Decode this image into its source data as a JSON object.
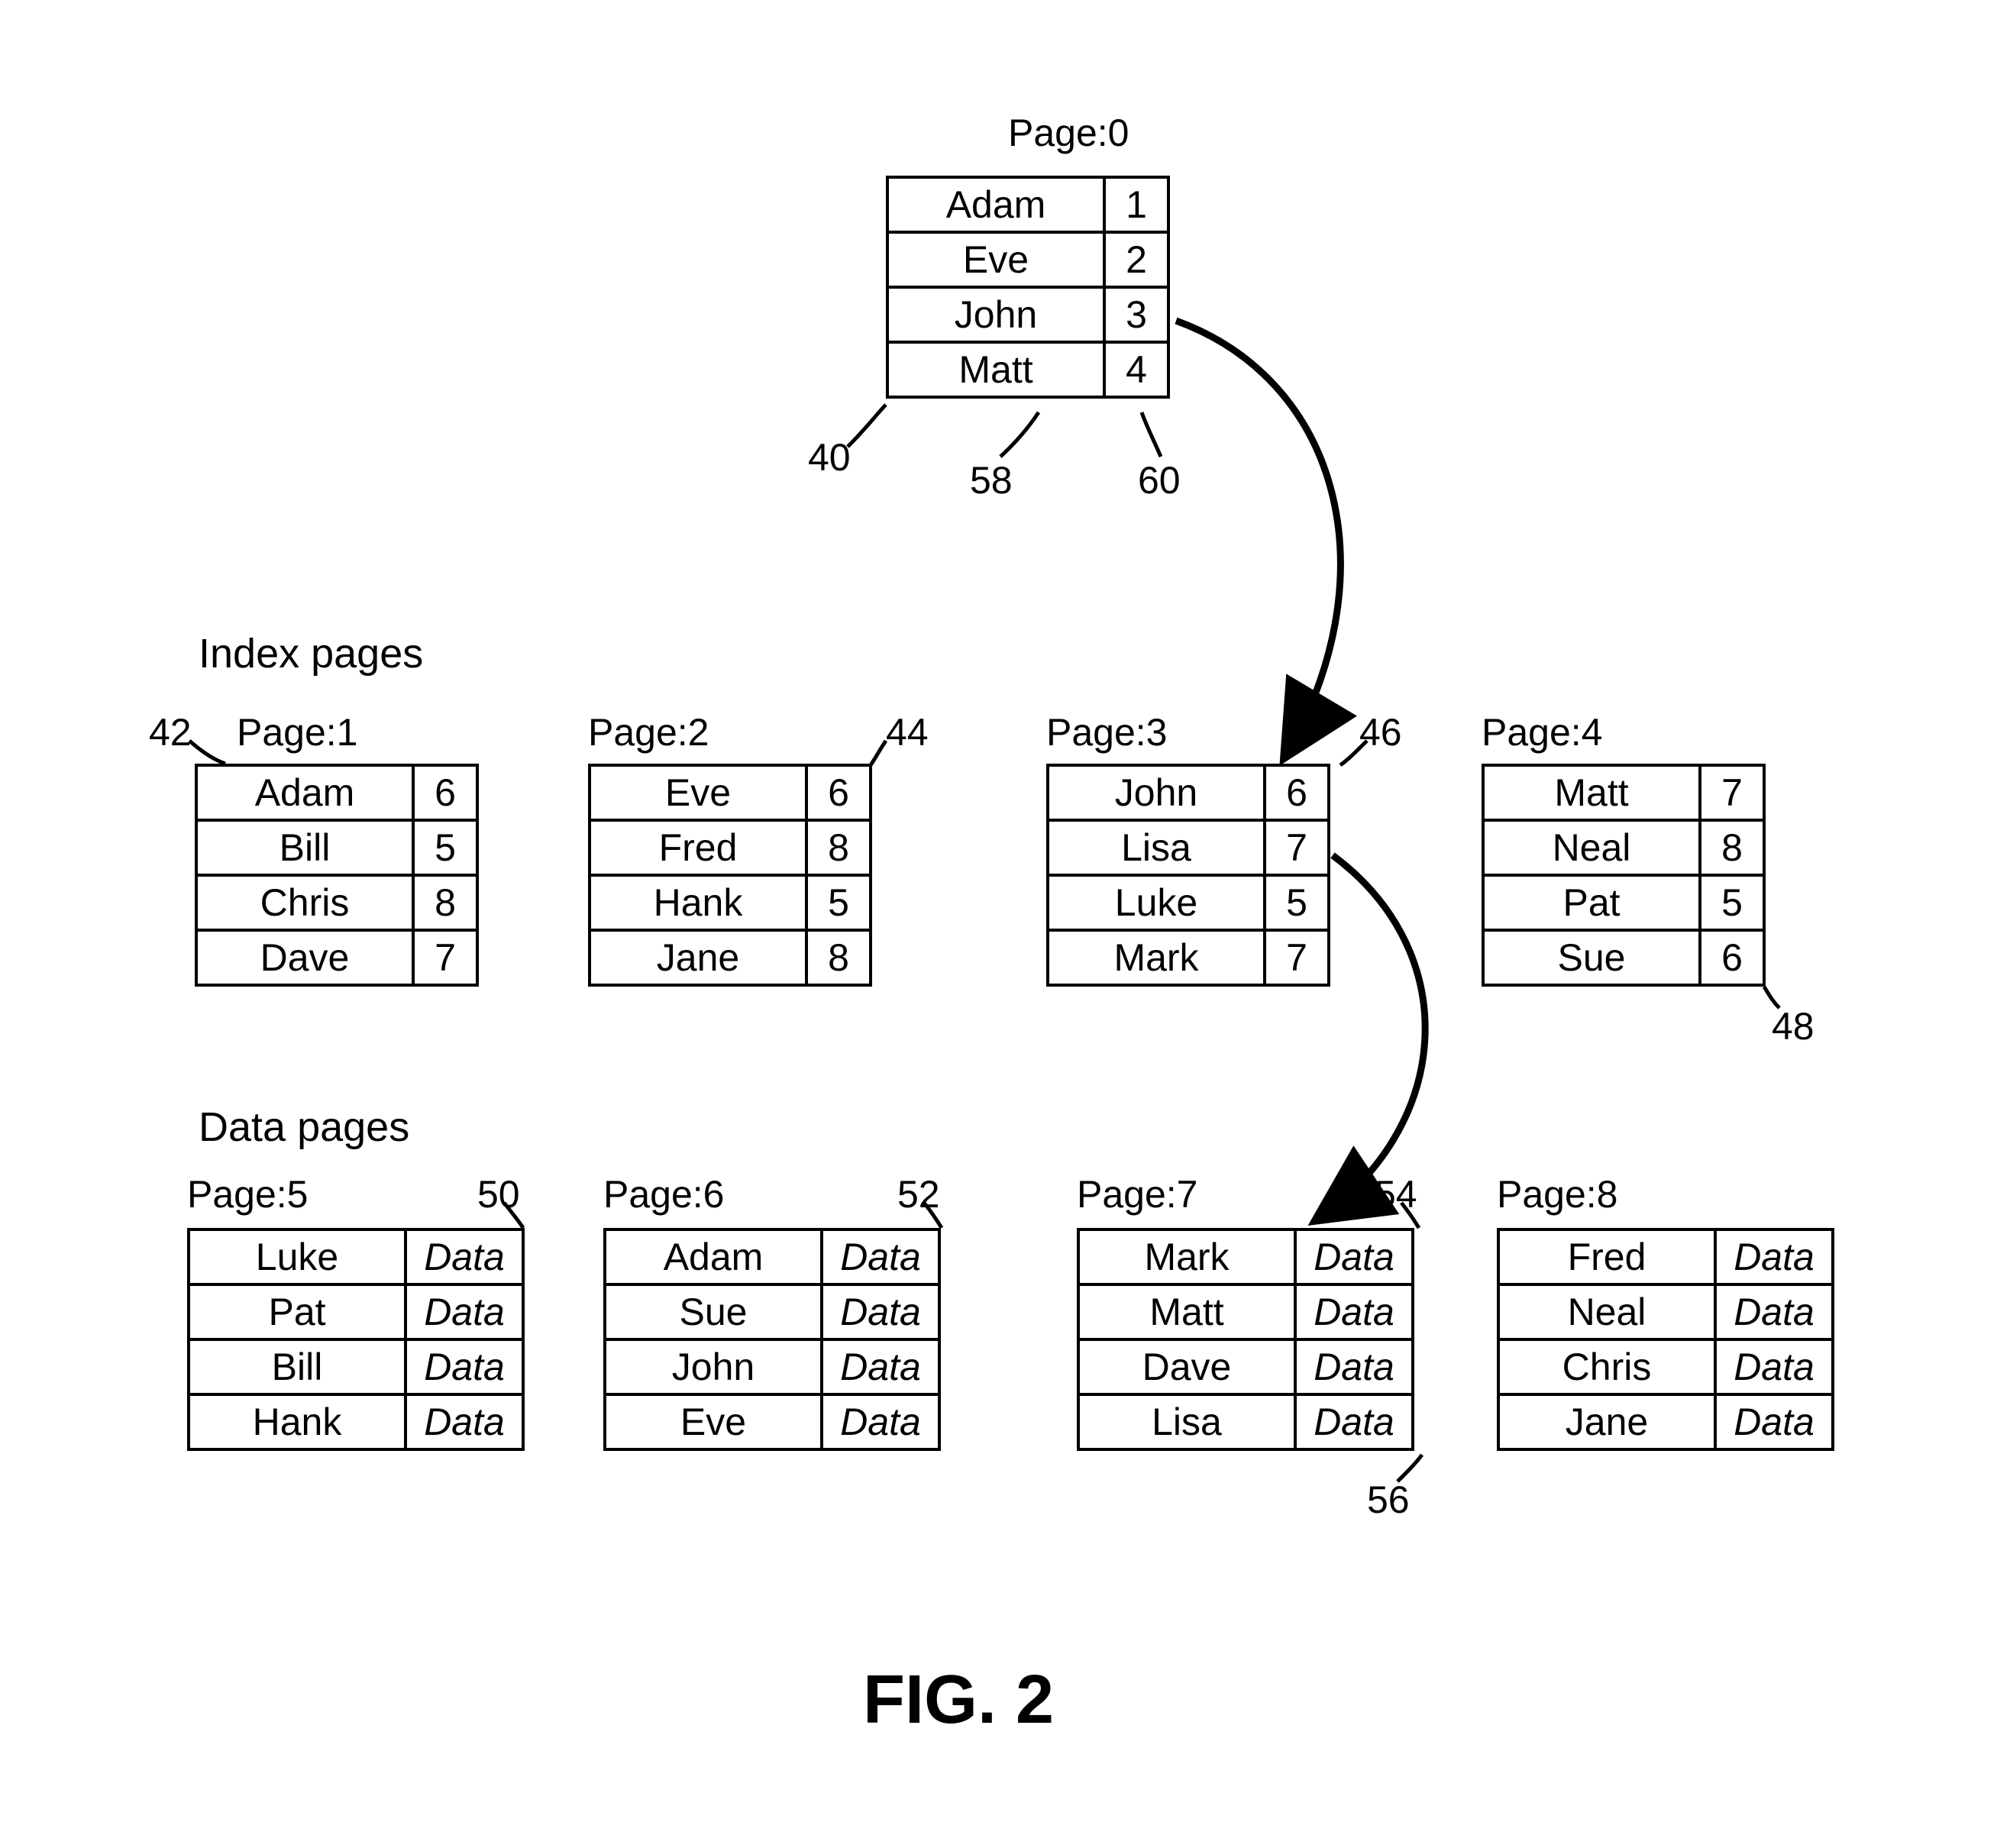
{
  "sections": {
    "index_label": "Index pages",
    "data_label": "Data pages",
    "figure_label": "FIG. 2"
  },
  "refs": {
    "r40": "40",
    "r42": "42",
    "r44": "44",
    "r46": "46",
    "r48": "48",
    "r50": "50",
    "r52": "52",
    "r54": "54",
    "r56": "56",
    "r58": "58",
    "r60": "60"
  },
  "pages": {
    "p0": {
      "title": "Page:0",
      "rows": [
        {
          "name": "Adam",
          "val": "1"
        },
        {
          "name": "Eve",
          "val": "2"
        },
        {
          "name": "John",
          "val": "3"
        },
        {
          "name": "Matt",
          "val": "4"
        }
      ]
    },
    "p1": {
      "title": "Page:1",
      "rows": [
        {
          "name": "Adam",
          "val": "6"
        },
        {
          "name": "Bill",
          "val": "5"
        },
        {
          "name": "Chris",
          "val": "8"
        },
        {
          "name": "Dave",
          "val": "7"
        }
      ]
    },
    "p2": {
      "title": "Page:2",
      "rows": [
        {
          "name": "Eve",
          "val": "6"
        },
        {
          "name": "Fred",
          "val": "8"
        },
        {
          "name": "Hank",
          "val": "5"
        },
        {
          "name": "Jane",
          "val": "8"
        }
      ]
    },
    "p3": {
      "title": "Page:3",
      "rows": [
        {
          "name": "John",
          "val": "6"
        },
        {
          "name": "Lisa",
          "val": "7"
        },
        {
          "name": "Luke",
          "val": "5"
        },
        {
          "name": "Mark",
          "val": "7"
        }
      ]
    },
    "p4": {
      "title": "Page:4",
      "rows": [
        {
          "name": "Matt",
          "val": "7"
        },
        {
          "name": "Neal",
          "val": "8"
        },
        {
          "name": "Pat",
          "val": "5"
        },
        {
          "name": "Sue",
          "val": "6"
        }
      ]
    },
    "p5": {
      "title": "Page:5",
      "rows": [
        {
          "name": "Luke",
          "val": "Data"
        },
        {
          "name": "Pat",
          "val": "Data"
        },
        {
          "name": "Bill",
          "val": "Data"
        },
        {
          "name": "Hank",
          "val": "Data"
        }
      ]
    },
    "p6": {
      "title": "Page:6",
      "rows": [
        {
          "name": "Adam",
          "val": "Data"
        },
        {
          "name": "Sue",
          "val": "Data"
        },
        {
          "name": "John",
          "val": "Data"
        },
        {
          "name": "Eve",
          "val": "Data"
        }
      ]
    },
    "p7": {
      "title": "Page:7",
      "rows": [
        {
          "name": "Mark",
          "val": "Data"
        },
        {
          "name": "Matt",
          "val": "Data"
        },
        {
          "name": "Dave",
          "val": "Data"
        },
        {
          "name": "Lisa",
          "val": "Data"
        }
      ]
    },
    "p8": {
      "title": "Page:8",
      "rows": [
        {
          "name": "Fred",
          "val": "Data"
        },
        {
          "name": "Neal",
          "val": "Data"
        },
        {
          "name": "Chris",
          "val": "Data"
        },
        {
          "name": "Jane",
          "val": "Data"
        }
      ]
    }
  }
}
